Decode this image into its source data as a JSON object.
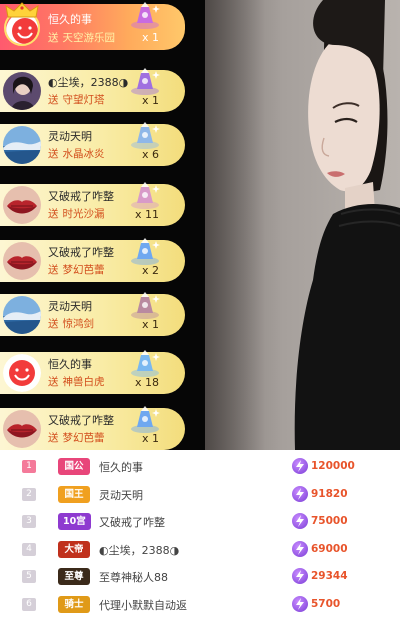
{
  "gift_feed": [
    {
      "user": "恒久的事",
      "gift_prefix": "送",
      "gift": "天空游乐园",
      "count": "x 1",
      "avatar": "smile",
      "vip": true
    },
    {
      "user": "◐尘埃，2388◑",
      "gift_prefix": "送",
      "gift": "守望灯塔",
      "count": "x 1",
      "avatar": "portrait"
    },
    {
      "user": "灵动天明",
      "gift_prefix": "送",
      "gift": "水晶冰炎",
      "count": "x 6",
      "avatar": "landscape"
    },
    {
      "user": "又破戒了咋整",
      "gift_prefix": "送",
      "gift": "时光沙漏",
      "count": "x 11",
      "avatar": "lips"
    },
    {
      "user": "又破戒了咋整",
      "gift_prefix": "送",
      "gift": "梦幻芭蕾",
      "count": "x 2",
      "avatar": "lips"
    },
    {
      "user": "灵动天明",
      "gift_prefix": "送",
      "gift": "惊鸿剑",
      "count": "x 1",
      "avatar": "landscape"
    },
    {
      "user": "恒久的事",
      "gift_prefix": "送",
      "gift": "神兽白虎",
      "count": "x 18",
      "avatar": "smile"
    },
    {
      "user": "又破戒了咋整",
      "gift_prefix": "送",
      "gift": "梦幻芭蕾",
      "count": "x 1",
      "avatar": "lips"
    }
  ],
  "ranking": [
    {
      "rank": "1",
      "badge": "国公",
      "badge_color": "#e8467a",
      "name": "恒久的事",
      "score": "120000"
    },
    {
      "rank": "2",
      "badge": "国王",
      "badge_color": "#f0a020",
      "name": "灵动天明",
      "score": "91820"
    },
    {
      "rank": "3",
      "badge": "10宫",
      "badge_color": "#8e3ad0",
      "name": "又破戒了咋整",
      "score": "75000"
    },
    {
      "rank": "4",
      "badge": "大帝",
      "badge_color": "#c0301c",
      "name": "◐尘埃，2388◑",
      "score": "69000"
    },
    {
      "rank": "5",
      "badge": "至尊",
      "badge_color": "#3b2a1a",
      "name": "至尊神秘人88",
      "score": "29344"
    },
    {
      "rank": "6",
      "badge": "骑士",
      "badge_color": "#e09a18",
      "name": "代理小默默自动返",
      "score": "5700"
    }
  ],
  "colors": {
    "accent": "#e8542b",
    "card_gold": "#f9eca6",
    "card_first": "#ff7a63",
    "bolt": "#8e3ad0"
  },
  "icons": {
    "score": "lightning-icon",
    "vip": "crown-icon"
  }
}
